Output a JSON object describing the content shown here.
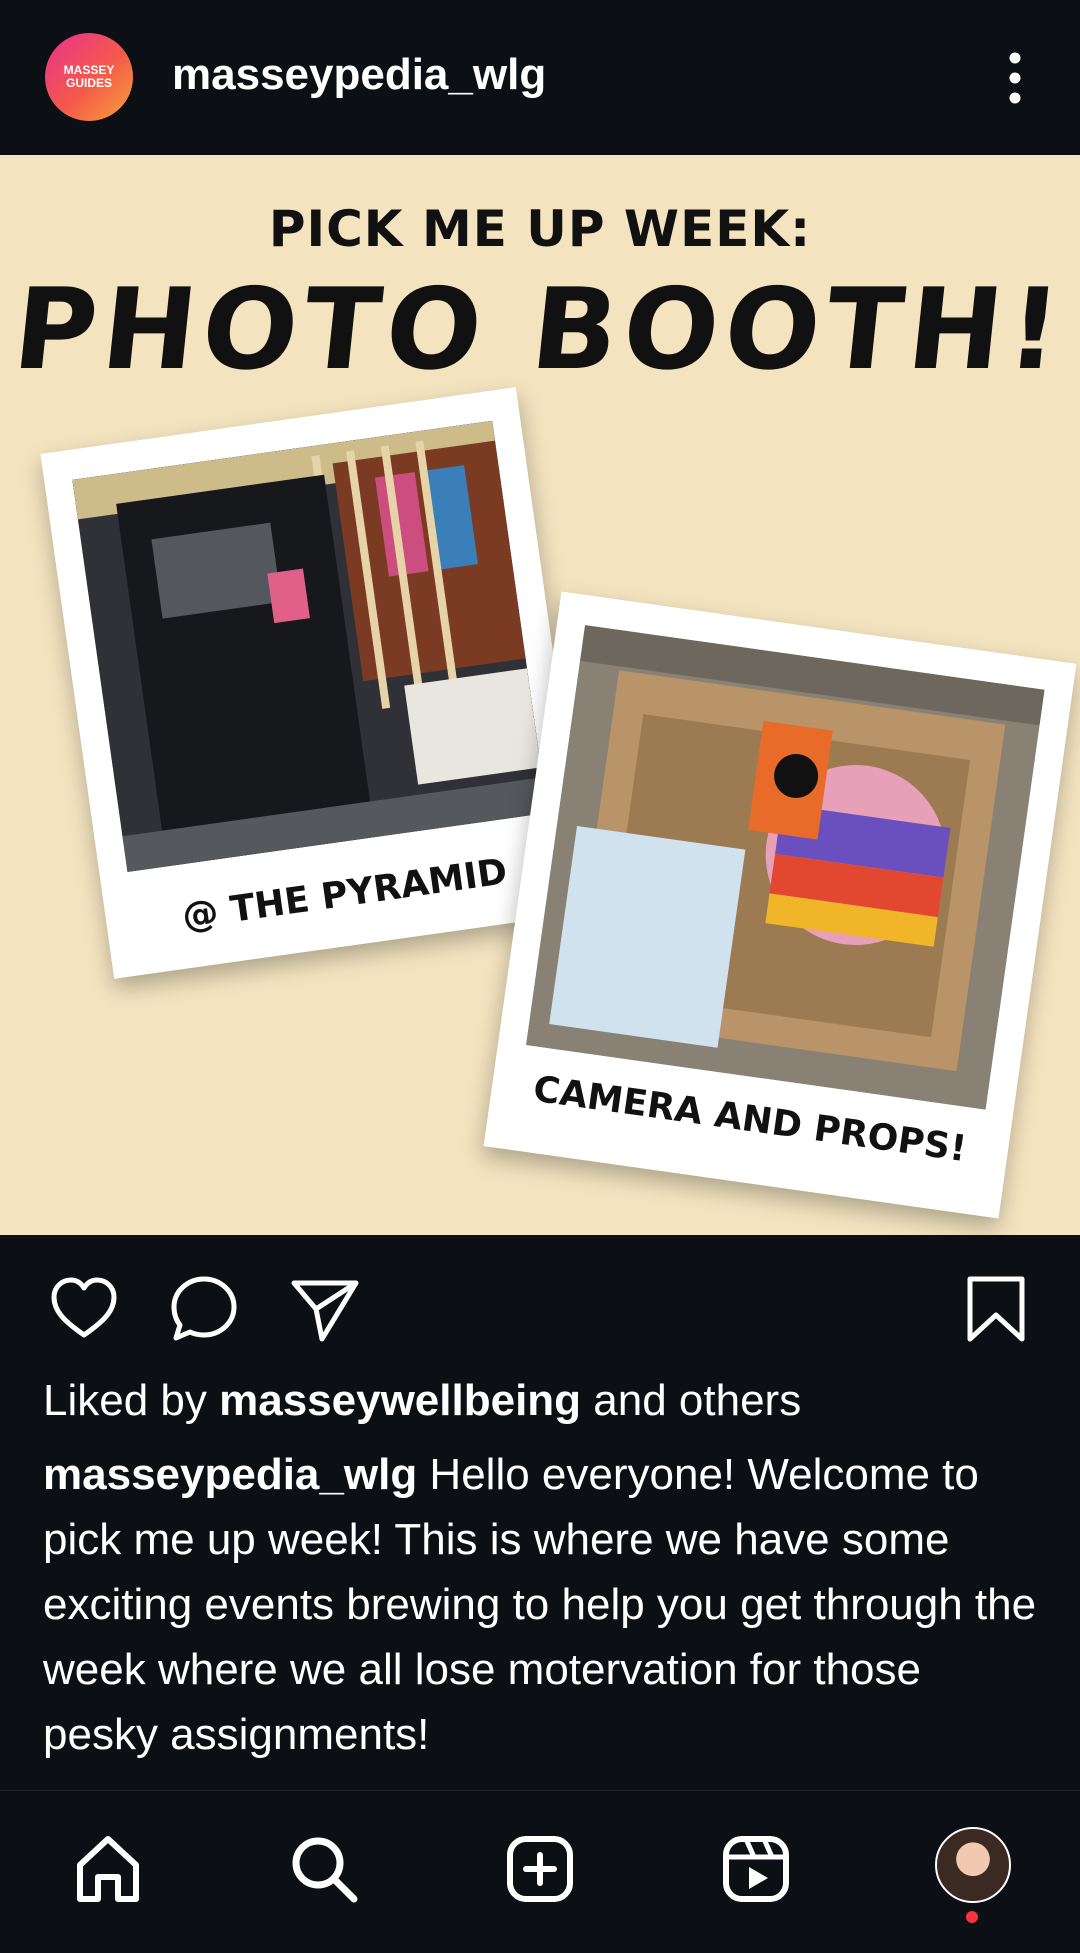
{
  "header": {
    "logo_line1": "MASSEY",
    "logo_line2": "GUIDES",
    "username": "masseypedia_wlg",
    "more_icon": "more-vertical-icon"
  },
  "post": {
    "subheading": "PICK ME UP WEEK:",
    "heading": "PHOTO BOOTH!",
    "polaroid_left_caption": "@ THE PYRAMID",
    "polaroid_right_caption": "CAMERA AND PROPS!"
  },
  "actions": {
    "like_icon": "heart-icon",
    "comment_icon": "comment-icon",
    "share_icon": "share-icon",
    "save_icon": "bookmark-icon"
  },
  "likes": {
    "prefix": "Liked by ",
    "user": "masseywellbeing",
    "suffix": " and others"
  },
  "caption": {
    "username": "masseypedia_wlg",
    "text": " Hello everyone! Welcome to pick me up week! This is where we have some exciting events brewing to help you get through the week where we all lose motervation for those pesky assignments!"
  },
  "bottom_nav": {
    "items": [
      "home-icon",
      "search-icon",
      "create-icon",
      "reels-icon",
      "profile-avatar"
    ]
  },
  "colors": {
    "background": "#0c0f14",
    "post_background": "#f3e3bf",
    "notification": "#ff3040"
  }
}
